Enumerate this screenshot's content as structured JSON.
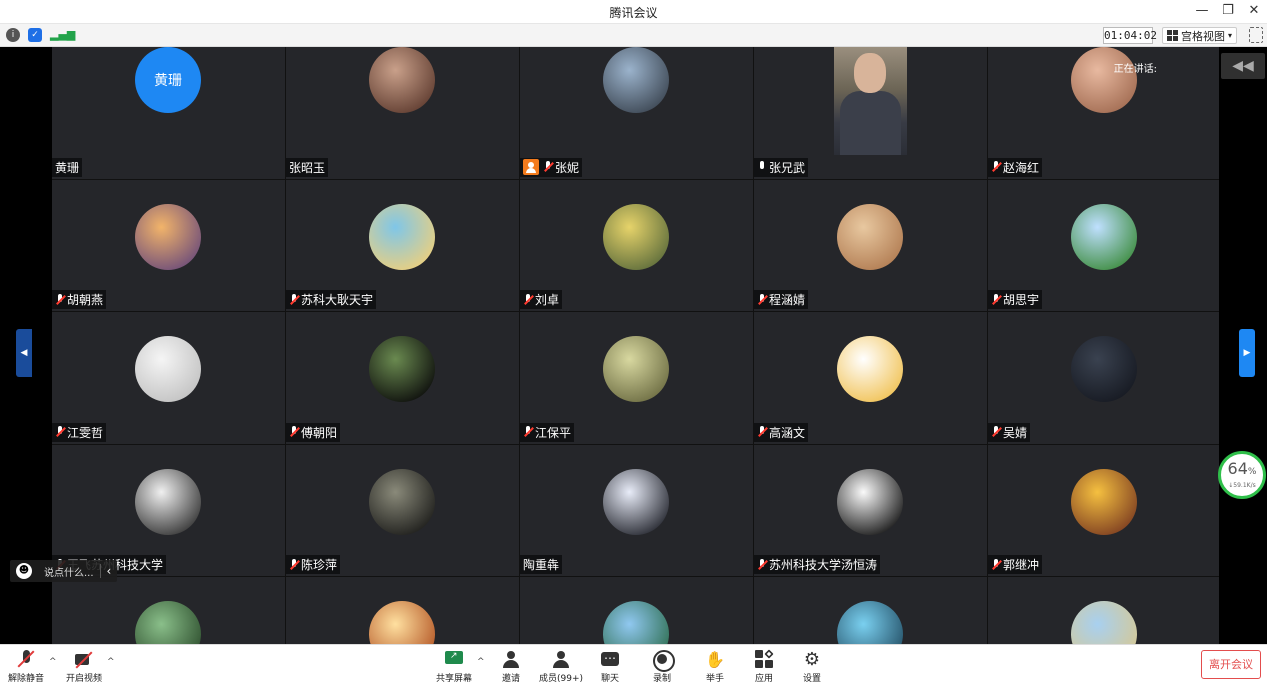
{
  "window": {
    "title": "腾讯会议"
  },
  "status": {
    "timer": "01:04:02",
    "view_label": "宫格视图"
  },
  "speaking": {
    "label": "正在讲话:"
  },
  "participants": [
    {
      "name": "黄珊",
      "mic": "muted",
      "avatar_text": "黄珊",
      "type": "letter",
      "c1": "#1e88f3",
      "c2": "#1e88f3",
      "noicon": true
    },
    {
      "name": "张昭玉",
      "mic": "none",
      "type": "photo",
      "c1": "#c9a08a",
      "c2": "#5d3a2e"
    },
    {
      "name": "张妮",
      "mic": "muted",
      "type": "photo",
      "host": true,
      "c1": "#9bb3cc",
      "c2": "#3a4450"
    },
    {
      "name": "张兄武",
      "mic": "on",
      "type": "video"
    },
    {
      "name": "赵海红",
      "mic": "muted",
      "type": "photo",
      "c1": "#e8b9a0",
      "c2": "#a06a50"
    },
    {
      "name": "胡朝燕",
      "mic": "muted",
      "type": "photo",
      "c1": "#f2b46a",
      "c2": "#6a4a7a"
    },
    {
      "name": "苏科大耿天宇",
      "mic": "muted",
      "type": "photo",
      "c1": "#7fc6e8",
      "c2": "#f0d07a"
    },
    {
      "name": "刘卓",
      "mic": "muted",
      "type": "photo",
      "c1": "#e6d36a",
      "c2": "#5a6a3a"
    },
    {
      "name": "程涵婧",
      "mic": "muted",
      "type": "photo",
      "c1": "#e8c8a0",
      "c2": "#b07a50"
    },
    {
      "name": "胡思宇",
      "mic": "muted",
      "type": "photo",
      "c1": "#bfe0ff",
      "c2": "#3a8a3a"
    },
    {
      "name": "江雯哲",
      "mic": "muted",
      "type": "photo",
      "c1": "#f5f5f5",
      "c2": "#c0c0c0"
    },
    {
      "name": "傅朝阳",
      "mic": "muted",
      "type": "photo",
      "c1": "#6a8a50",
      "c2": "#0a0a0a"
    },
    {
      "name": "江保平",
      "mic": "muted",
      "type": "photo",
      "c1": "#d8d8a0",
      "c2": "#6a6a40"
    },
    {
      "name": "高涵文",
      "mic": "muted",
      "type": "photo",
      "c1": "#ffffff",
      "c2": "#f0c050"
    },
    {
      "name": "吴婧",
      "mic": "muted",
      "type": "photo",
      "c1": "#3a4250",
      "c2": "#151820"
    },
    {
      "name": "王飞苏州科技大学",
      "mic": "muted",
      "type": "photo",
      "c1": "#f0f0f0",
      "c2": "#303030"
    },
    {
      "name": "陈珍萍",
      "mic": "muted",
      "type": "photo",
      "c1": "#8a8a7a",
      "c2": "#1a1a18"
    },
    {
      "name": "陶重犇",
      "mic": "none",
      "type": "photo",
      "c1": "#e8ecf8",
      "c2": "#20222a"
    },
    {
      "name": "苏州科技大学汤恒涛",
      "mic": "muted",
      "type": "photo",
      "c1": "#fafafa",
      "c2": "#111111"
    },
    {
      "name": "郭继冲",
      "mic": "muted",
      "type": "photo",
      "c1": "#f5c040",
      "c2": "#7a3a20"
    },
    {
      "name": "",
      "mic": "none",
      "type": "photo",
      "c1": "#8abf8a",
      "c2": "#2a4a2a"
    },
    {
      "name": "",
      "mic": "none",
      "type": "photo",
      "c1": "#ffe0a0",
      "c2": "#b05020"
    },
    {
      "name": "",
      "mic": "none",
      "type": "photo",
      "c1": "#90c8f0",
      "c2": "#2a6a4a"
    },
    {
      "name": "",
      "mic": "none",
      "type": "photo",
      "c1": "#7ad0f0",
      "c2": "#204a60"
    },
    {
      "name": "",
      "mic": "none",
      "type": "photo",
      "c1": "#a8d0f0",
      "c2": "#d8c890"
    }
  ],
  "network": {
    "percent": "64",
    "percent_unit": "%",
    "speed": "↓59.1K/s"
  },
  "chat": {
    "placeholder": "说点什么..."
  },
  "toolbar": {
    "unmute": "解除静音",
    "start_video": "开启视频",
    "share": "共享屏幕",
    "invite": "邀请",
    "members": "成员(99+)",
    "chat": "聊天",
    "record": "录制",
    "raise_hand": "举手",
    "apps": "应用",
    "settings": "设置",
    "leave": "离开会议"
  }
}
